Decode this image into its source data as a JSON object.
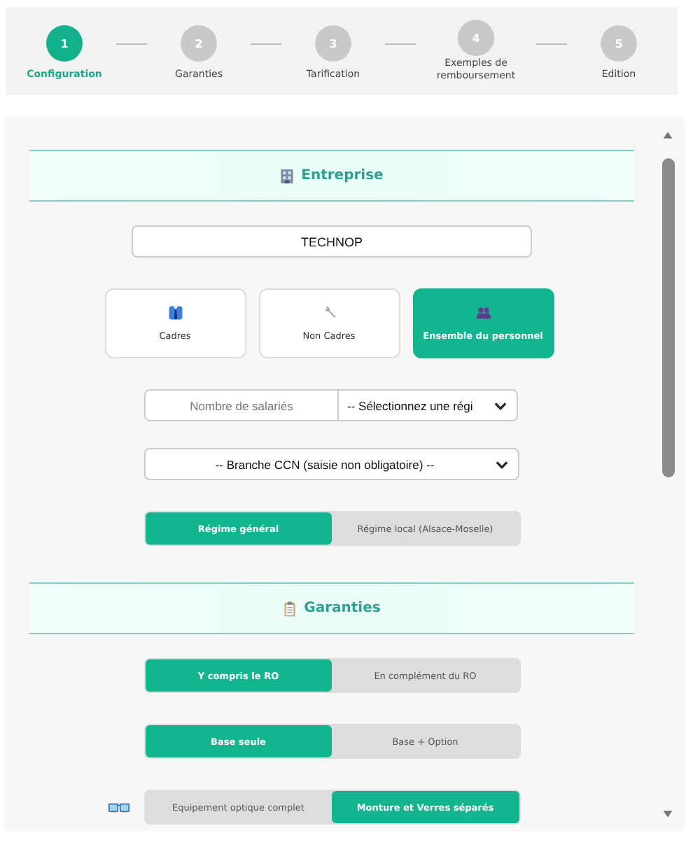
{
  "steps": [
    {
      "number": "1",
      "label": "Configuration",
      "selected": true
    },
    {
      "number": "2",
      "label": "Garanties",
      "selected": false
    },
    {
      "number": "3",
      "label": "Tarification",
      "selected": false
    },
    {
      "number": "4",
      "label": "Exemples de remboursement",
      "selected": false
    },
    {
      "number": "5",
      "label": "Edition",
      "selected": false
    }
  ],
  "entreprise": {
    "title": "Entreprise",
    "company_name": "TECHNOP",
    "categories": [
      {
        "label": "Cadres",
        "kind": "suit",
        "selected": false
      },
      {
        "label": "Non Cadres",
        "kind": "wrench",
        "selected": false
      },
      {
        "label": "Ensemble du personnel",
        "kind": "people",
        "selected": true
      }
    ],
    "employees": {
      "placeholder": "Nombre de salariés"
    },
    "region": {
      "value": "-- Sélectionnez une régi"
    },
    "branch": {
      "value": "-- Branche CCN (saisie non obligatoire) --"
    },
    "regime": [
      {
        "label": "Régime général",
        "selected": true
      },
      {
        "label": "Régime local (Alsace-Moselle)",
        "selected": false
      }
    ]
  },
  "garanties": {
    "title": "Garanties",
    "toggles": [
      {
        "kind": "plain",
        "options": [
          {
            "label": "Y compris le RO",
            "selected": true
          },
          {
            "label": "En complément du RO",
            "selected": false
          }
        ]
      },
      {
        "kind": "plain",
        "options": [
          {
            "label": "Base seule",
            "selected": true
          },
          {
            "label": "Base + Option",
            "selected": false
          }
        ]
      },
      {
        "kind": "optics",
        "options": [
          {
            "label": "Equipement optique complet",
            "selected": false
          },
          {
            "label": "Monture et Verres séparés",
            "selected": true
          }
        ]
      }
    ]
  }
}
